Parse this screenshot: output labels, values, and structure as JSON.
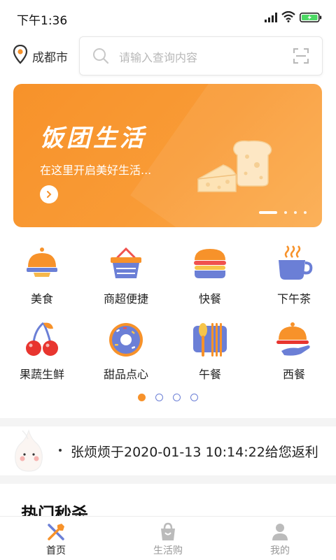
{
  "status_bar": {
    "time": "下午1:36"
  },
  "header": {
    "city": "成都市",
    "search_placeholder": "请输入查询内容"
  },
  "banner": {
    "title": "饭团生活",
    "subtitle": "在这里开启美好生活...",
    "page_count": 4,
    "active_page": 1
  },
  "categories": [
    {
      "label": "美食",
      "icon": "food-cloche-icon"
    },
    {
      "label": "商超便捷",
      "icon": "basket-icon"
    },
    {
      "label": "快餐",
      "icon": "burger-icon"
    },
    {
      "label": "下午茶",
      "icon": "coffee-cup-icon"
    },
    {
      "label": "果蔬生鲜",
      "icon": "cherry-icon"
    },
    {
      "label": "甜品点心",
      "icon": "donut-icon"
    },
    {
      "label": "午餐",
      "icon": "utensils-icon"
    },
    {
      "label": "西餐",
      "icon": "serving-tray-icon"
    }
  ],
  "category_pager": {
    "count": 4,
    "active": 1
  },
  "notice": {
    "text": "张烦烦于2020-01-13 10:14:22给您返利"
  },
  "section": {
    "title": "热门秒杀"
  },
  "tabs": [
    {
      "label": "首页",
      "icon": "home-utensils-icon",
      "active": true
    },
    {
      "label": "生活购",
      "icon": "shopping-bag-icon",
      "active": false
    },
    {
      "label": "我的",
      "icon": "user-icon",
      "active": false
    }
  ],
  "colors": {
    "accent": "#f7922a",
    "pager_inactive": "#6b7fd6",
    "tab_active": "#222222",
    "tab_inactive": "#999999"
  }
}
